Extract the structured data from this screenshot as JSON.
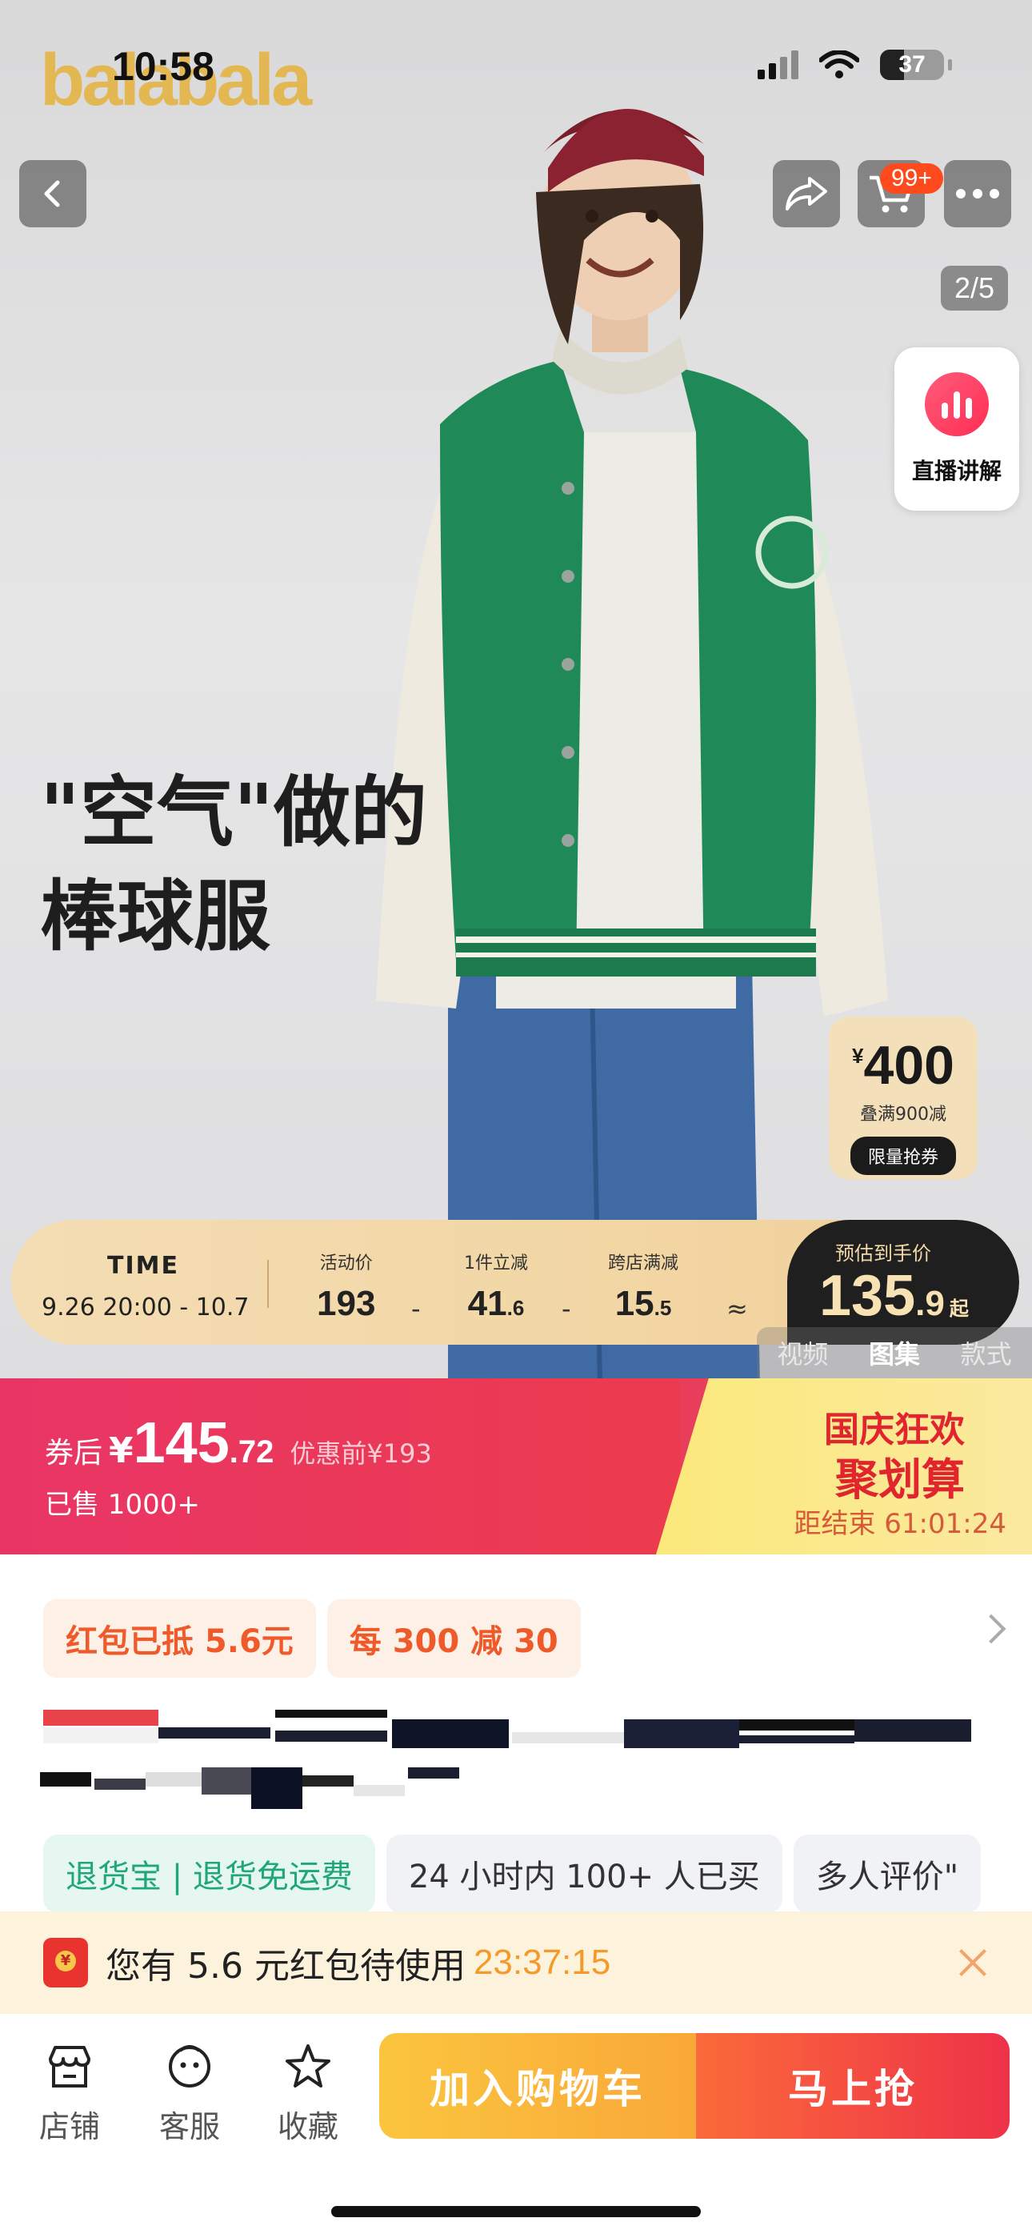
{
  "status_bar": {
    "time": "10:58",
    "battery": "37"
  },
  "hero": {
    "brand_logo": "balabala",
    "cart_badge": "99+",
    "page_counter": "2/5",
    "live_label": "直播讲解",
    "slogan_line1": "\"空气\"做的",
    "slogan_line2": "棒球服",
    "coupon": {
      "currency": "¥",
      "amount": "400",
      "note": "叠满900减",
      "button": "限量抢券"
    },
    "promo": {
      "time_label": "TIME",
      "time_range": "9.26  20:00 - 10.7",
      "activity_price_label": "活动价",
      "activity_price": "193",
      "one_item_label": "1件立减",
      "one_item_int": "41",
      "one_item_dec": ".6",
      "cross_store_label": "跨店满减",
      "cross_store_int": "15",
      "cross_store_dec": ".5",
      "minus": "-",
      "approx": "≈",
      "estimate_label": "预估到手价",
      "estimate_int": "135",
      "estimate_dec": ".9",
      "estimate_suffix": "起"
    },
    "media_tabs": [
      "视频",
      "图集",
      "款式"
    ],
    "active_media_tab": "图集",
    "colors": {
      "logo": "#e3b752",
      "jacket": "#1f8a58",
      "promo": "#f2d6a4"
    }
  },
  "price": {
    "label": "券后",
    "currency": "¥",
    "int": "145",
    "dec": ".72",
    "original": "优惠前¥193",
    "sold": "已售 1000+"
  },
  "event": {
    "line1": "国庆狂欢",
    "line2": "聚划算",
    "countdown": "距结束 61:01:24"
  },
  "tags": [
    "红包已抵 5.6元",
    "每 300 减 30"
  ],
  "chips": [
    "退货宝 | 退货免运费",
    "24 小时内 100+ 人已买",
    "多人评价\""
  ],
  "notice": {
    "text": "您有 5.6 元红包待使用",
    "timer": "23:37:15"
  },
  "bottom": {
    "store": "店铺",
    "service": "客服",
    "favorite": "收藏",
    "add_to_cart": "加入购物车",
    "buy_now": "马上抢"
  },
  "icons": [
    "back-icon",
    "share-icon",
    "cart-icon",
    "more-icon",
    "live-chart-icon",
    "chevron-right-icon",
    "red-packet-icon",
    "close-icon",
    "store-icon",
    "service-icon",
    "star-icon"
  ]
}
